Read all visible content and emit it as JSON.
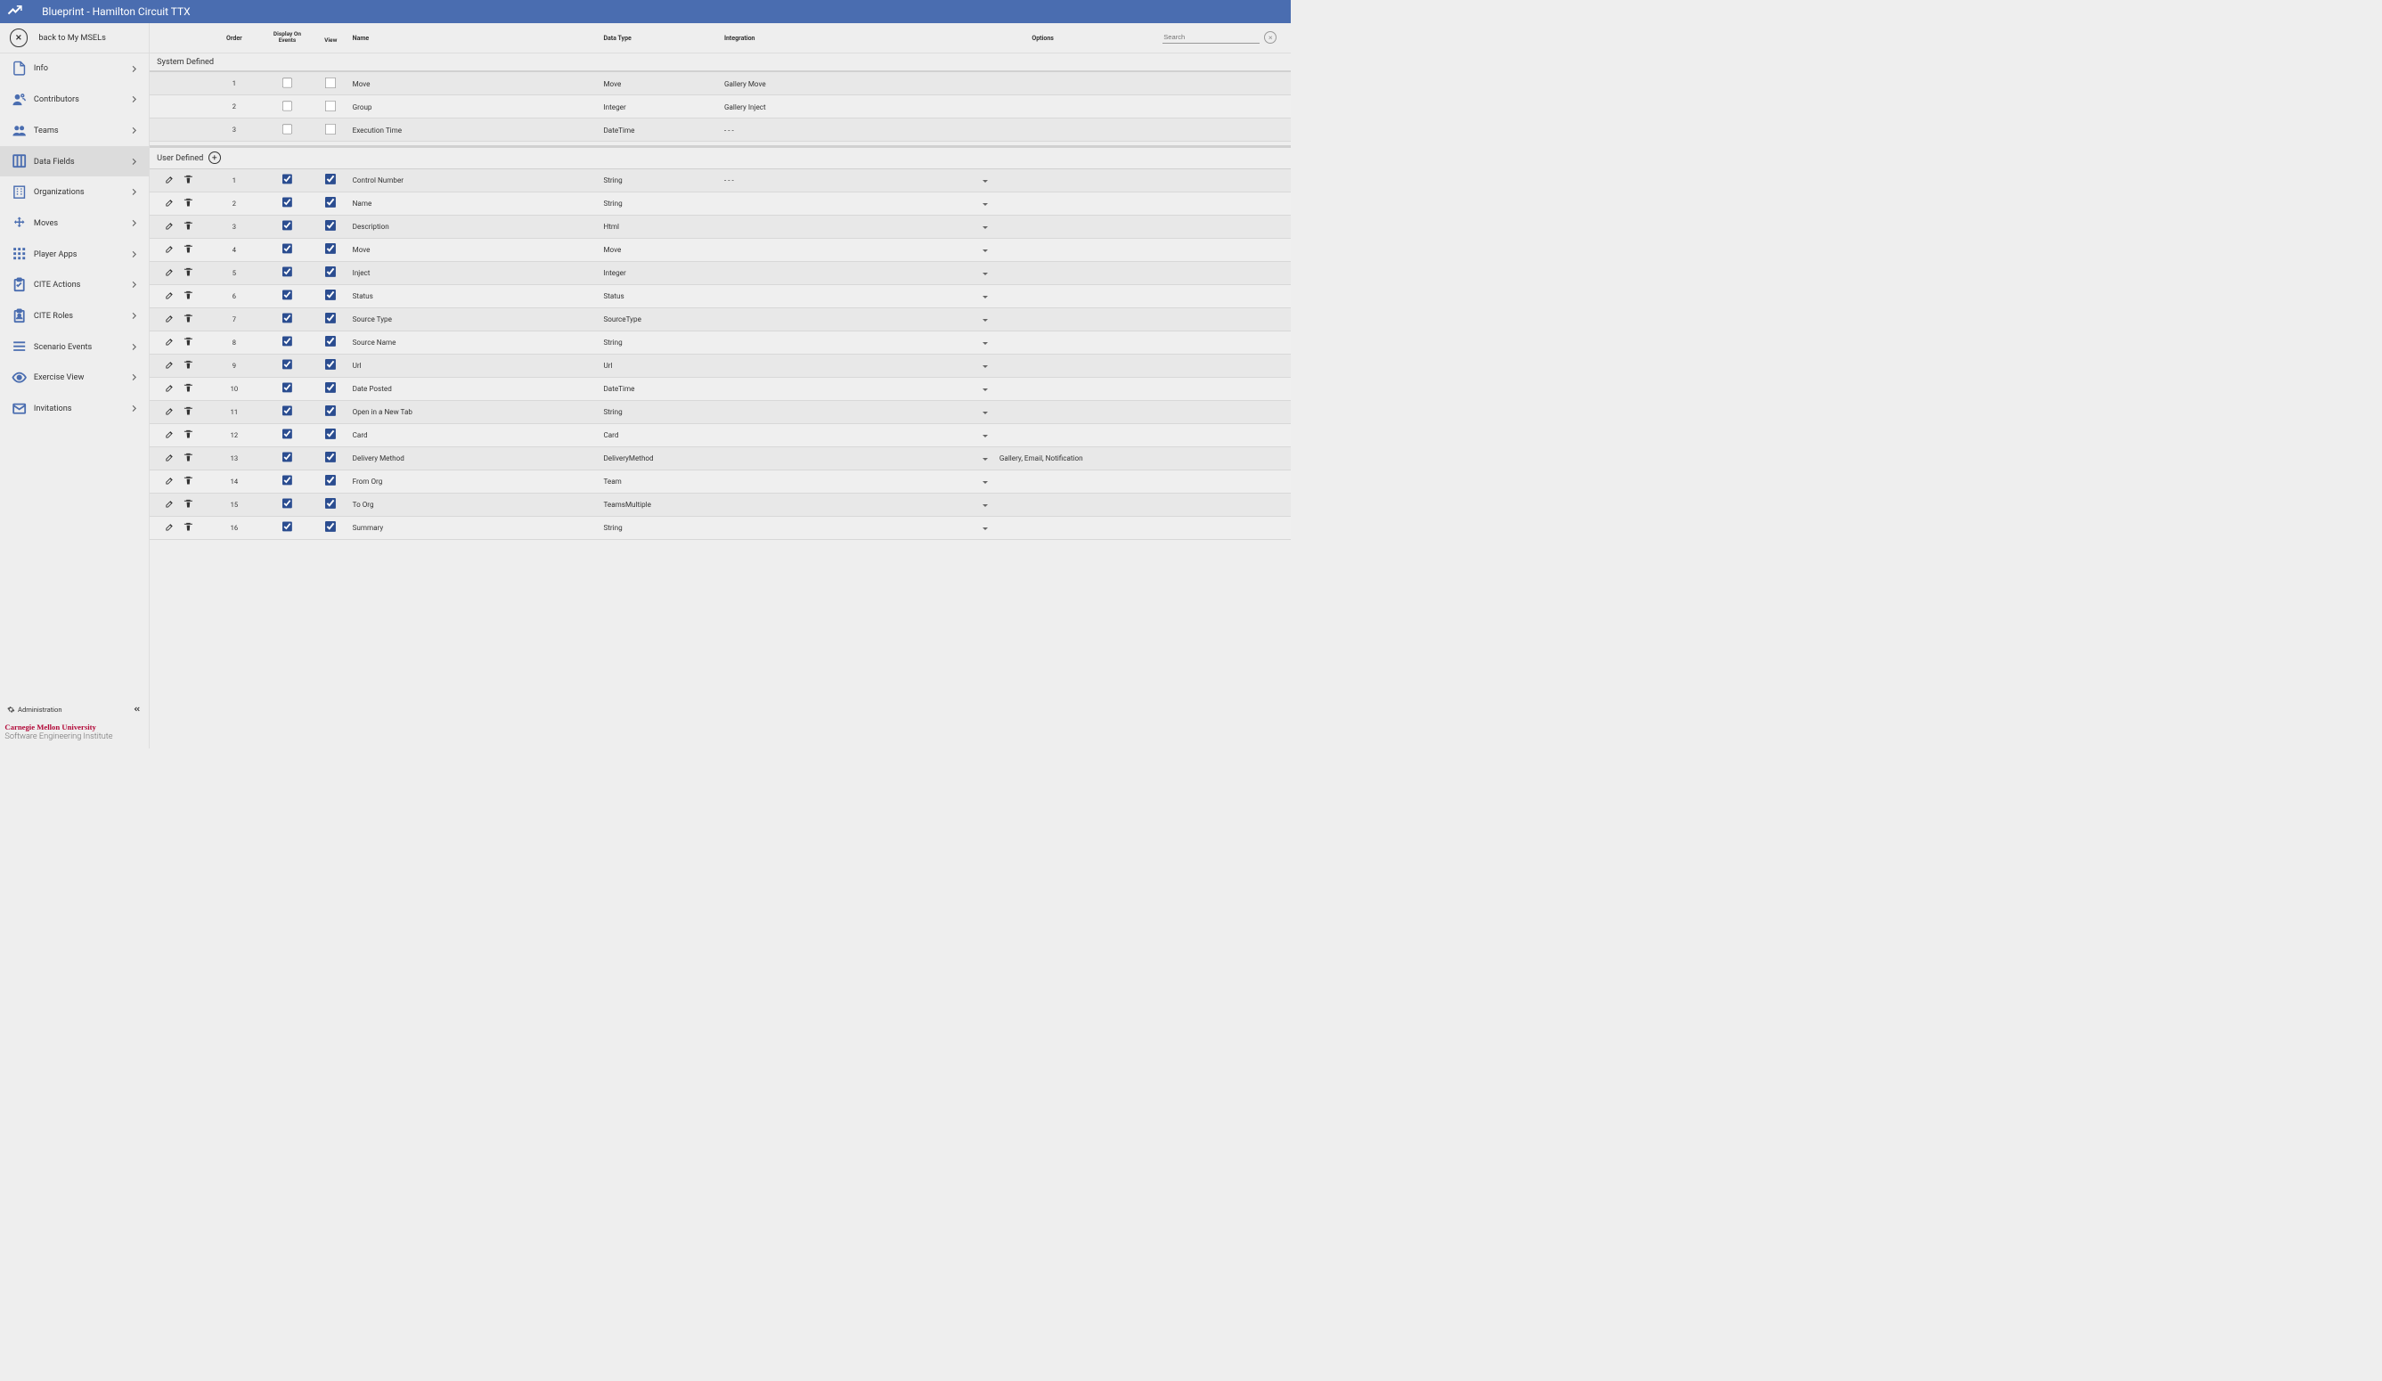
{
  "topbar": {
    "title": "Blueprint - Hamilton Circuit TTX"
  },
  "back": {
    "label": "back to My MSELs"
  },
  "sidebar": {
    "items": [
      {
        "id": "info",
        "label": "Info"
      },
      {
        "id": "contributors",
        "label": "Contributors"
      },
      {
        "id": "teams",
        "label": "Teams"
      },
      {
        "id": "data-fields",
        "label": "Data Fields",
        "active": true
      },
      {
        "id": "organizations",
        "label": "Organizations"
      },
      {
        "id": "moves",
        "label": "Moves"
      },
      {
        "id": "player-apps",
        "label": "Player Apps"
      },
      {
        "id": "cite-actions",
        "label": "CITE Actions"
      },
      {
        "id": "cite-roles",
        "label": "CITE Roles"
      },
      {
        "id": "scenario-events",
        "label": "Scenario Events"
      },
      {
        "id": "exercise-view",
        "label": "Exercise View"
      },
      {
        "id": "invitations",
        "label": "Invitations"
      }
    ],
    "admin_label": "Administration",
    "footer_line1": "Carnegie Mellon University",
    "footer_line2": "Software Engineering Institute"
  },
  "headers": {
    "order": "Order",
    "display_on": "Display On",
    "events": "Events",
    "view": "View",
    "name": "Name",
    "data_type": "Data Type",
    "integration": "Integration",
    "options": "Options",
    "search_placeholder": "Search"
  },
  "sections": {
    "system_defined": "System Defined",
    "user_defined": "User Defined"
  },
  "system_rows": [
    {
      "order": "1",
      "events": false,
      "view": false,
      "name": "Move",
      "type": "Move",
      "integration": "Gallery Move",
      "options_text": ""
    },
    {
      "order": "2",
      "events": false,
      "view": false,
      "name": "Group",
      "type": "Integer",
      "integration": "Gallery Inject",
      "options_text": ""
    },
    {
      "order": "3",
      "events": false,
      "view": false,
      "name": "Execution Time",
      "type": "DateTime",
      "integration": "- - -",
      "options_text": ""
    }
  ],
  "user_rows": [
    {
      "order": "1",
      "events": true,
      "view": true,
      "name": "Control Number",
      "type": "String",
      "integration": "- - -",
      "options_text": ""
    },
    {
      "order": "2",
      "events": true,
      "view": true,
      "name": "Name",
      "type": "String",
      "integration": "",
      "options_text": ""
    },
    {
      "order": "3",
      "events": true,
      "view": true,
      "name": "Description",
      "type": "Html",
      "integration": "",
      "options_text": ""
    },
    {
      "order": "4",
      "events": true,
      "view": true,
      "name": "Move",
      "type": "Move",
      "integration": "",
      "options_text": ""
    },
    {
      "order": "5",
      "events": true,
      "view": true,
      "name": "Inject",
      "type": "Integer",
      "integration": "",
      "options_text": ""
    },
    {
      "order": "6",
      "events": true,
      "view": true,
      "name": "Status",
      "type": "Status",
      "integration": "",
      "options_text": ""
    },
    {
      "order": "7",
      "events": true,
      "view": true,
      "name": "Source Type",
      "type": "SourceType",
      "integration": "",
      "options_text": ""
    },
    {
      "order": "8",
      "events": true,
      "view": true,
      "name": "Source Name",
      "type": "String",
      "integration": "",
      "options_text": ""
    },
    {
      "order": "9",
      "events": true,
      "view": true,
      "name": "Url",
      "type": "Url",
      "integration": "",
      "options_text": ""
    },
    {
      "order": "10",
      "events": true,
      "view": true,
      "name": "Date Posted",
      "type": "DateTime",
      "integration": "",
      "options_text": ""
    },
    {
      "order": "11",
      "events": true,
      "view": true,
      "name": "Open in a New Tab",
      "type": "String",
      "integration": "",
      "options_text": ""
    },
    {
      "order": "12",
      "events": true,
      "view": true,
      "name": "Card",
      "type": "Card",
      "integration": "",
      "options_text": ""
    },
    {
      "order": "13",
      "events": true,
      "view": true,
      "name": "Delivery Method",
      "type": "DeliveryMethod",
      "integration": "",
      "options_text": "Gallery, Email, Notification"
    },
    {
      "order": "14",
      "events": true,
      "view": true,
      "name": "From Org",
      "type": "Team",
      "integration": "",
      "options_text": ""
    },
    {
      "order": "15",
      "events": true,
      "view": true,
      "name": "To Org",
      "type": "TeamsMultiple",
      "integration": "",
      "options_text": ""
    },
    {
      "order": "16",
      "events": true,
      "view": true,
      "name": "Summary",
      "type": "String",
      "integration": "",
      "options_text": ""
    }
  ]
}
